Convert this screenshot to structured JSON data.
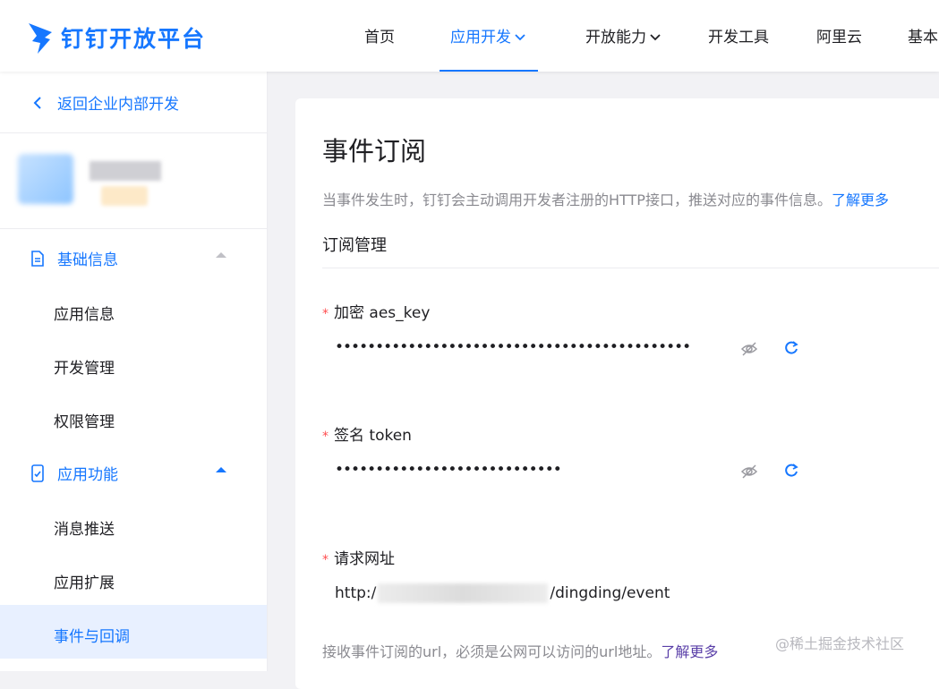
{
  "header": {
    "logo_text": "钉钉开放平台",
    "nav": [
      {
        "label": "首页"
      },
      {
        "label": "应用开发"
      },
      {
        "label": "开放能力"
      },
      {
        "label": "开发工具"
      },
      {
        "label": "阿里云"
      },
      {
        "label": "基本"
      }
    ],
    "active_nav": "应用开发"
  },
  "sidebar": {
    "back_label": "返回企业内部开发",
    "groups": [
      {
        "label": "基础信息",
        "expanded": false,
        "items": [
          "应用信息",
          "开发管理",
          "权限管理"
        ]
      },
      {
        "label": "应用功能",
        "expanded": true,
        "items": [
          "消息推送",
          "应用扩展",
          "事件与回调"
        ]
      }
    ],
    "active_item": "事件与回调"
  },
  "main": {
    "title": "事件订阅",
    "description": "当事件发生时，钉钉会主动调用开发者注册的HTTP接口，推送对应的事件信息。",
    "description_link": "了解更多",
    "section_title": "订阅管理",
    "fields": [
      {
        "label": "加密 aes_key",
        "value": "••••••••••••••••••••••••••••••••••••••••••••"
      },
      {
        "label": "签名 token",
        "value": "••••••••••••••••••••••••••••"
      },
      {
        "label": "请求网址",
        "value_prefix": "http:/",
        "value_suffix": "/dingding/event"
      }
    ],
    "hint": "接收事件订阅的url，必须是公网可以访问的url地址。",
    "hint_link": "了解更多"
  },
  "watermark": "@稀土掘金技术社区",
  "colors": {
    "accent": "#1677ff",
    "required": "#ff4d4f",
    "active_bg": "#e8f0ff"
  },
  "icons": [
    "logo-icon",
    "chevron-down-icon",
    "chevron-left-icon",
    "document-icon",
    "app-phone-icon",
    "caret-up-icon",
    "eye-off-icon",
    "refresh-icon"
  ]
}
